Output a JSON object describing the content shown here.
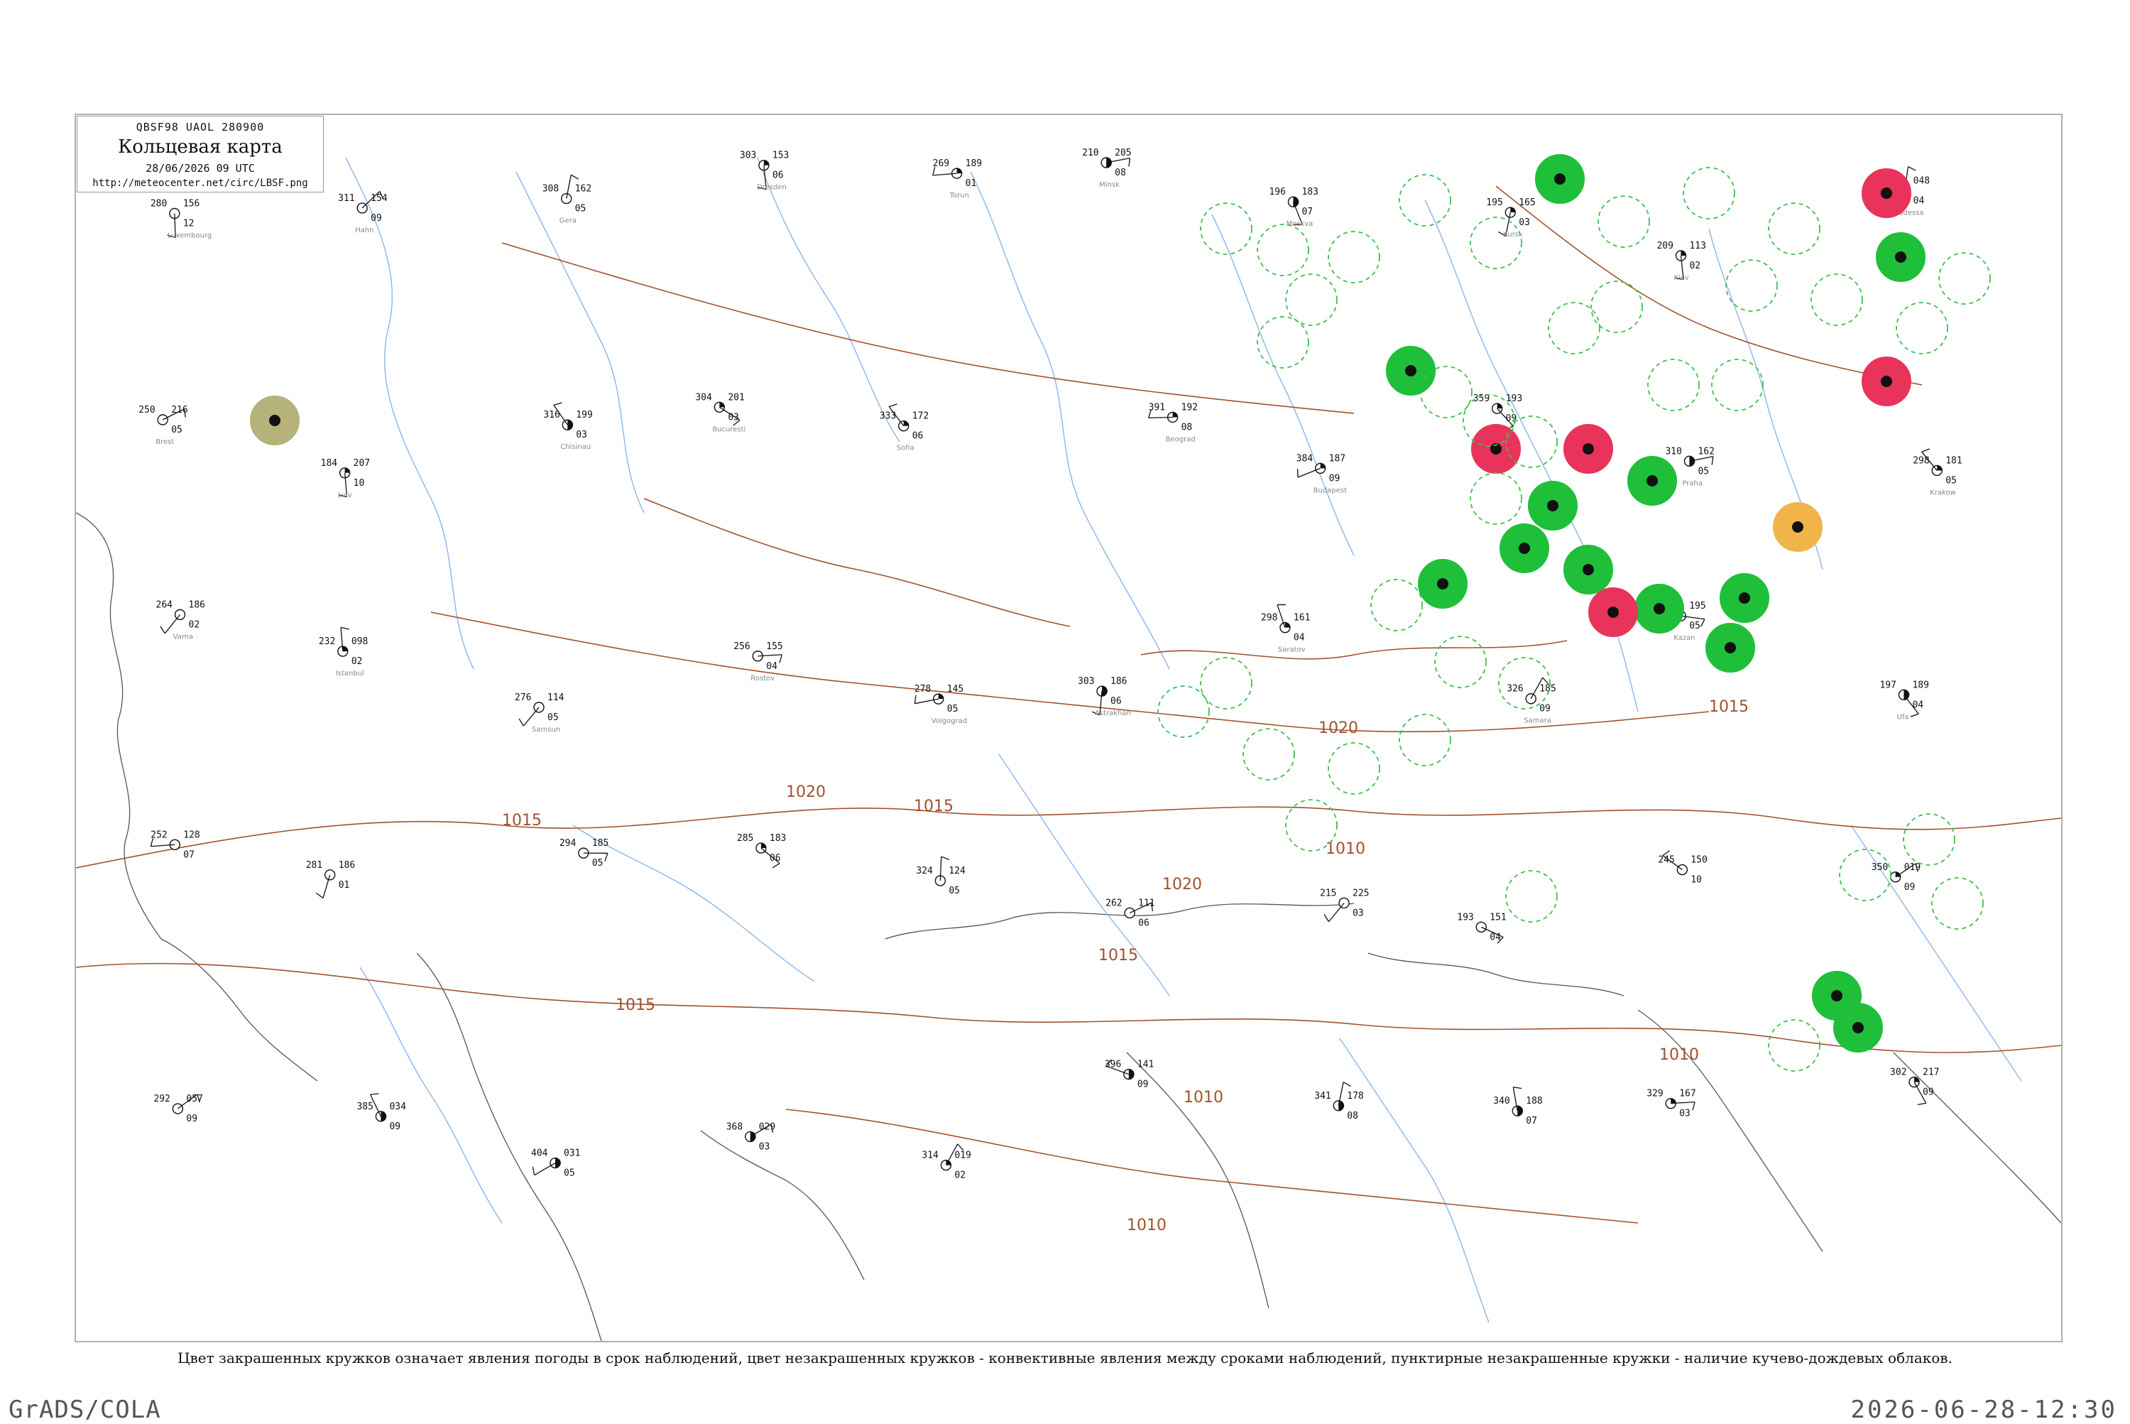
{
  "title_box": {
    "header": "QBSF98  UAOL  280900",
    "title": "Кольцевая карта",
    "datetime": "28/06/2026 09 UTC",
    "url": "http://meteocenter.net/circ/LBSF.png"
  },
  "caption": "Цвет закрашенных кружков означает явления погоды в срок наблюдений, цвет незакрашенных кружков - конвективные явления между сроками наблюдений, пунктирные незакрашенные кружки - наличие кучево-дождевых облаков.",
  "footer": {
    "left": "GrADS/COLA",
    "right": "2026-06-28-12:30"
  },
  "colors": {
    "isobar": "#a0522d",
    "river": "#8ab6e8",
    "coast": "#555555",
    "rain_fill": "#1fbf3a",
    "thunder_fill": "#e8345a",
    "shower_fill": "#f0b44a",
    "fog_fill": "#b5b27a",
    "cb_dash": "#3fbf4f"
  },
  "isobars": [
    {
      "label": "1015"
    },
    {
      "label": "1010"
    },
    {
      "label": "1015"
    },
    {
      "label": "1020"
    },
    {
      "label": "1020"
    },
    {
      "label": "1015"
    },
    {
      "label": "1020"
    },
    {
      "label": "1015"
    },
    {
      "label": "1010"
    },
    {
      "label": "1010"
    },
    {
      "label": "1010"
    },
    {
      "label": "1015"
    }
  ],
  "stations": [
    {
      "t": "280",
      "p": "156",
      "td": "12",
      "id": "s1"
    },
    {
      "t": "311",
      "p": "154",
      "td": "09",
      "id": "s2"
    },
    {
      "t": "308",
      "p": "162",
      "td": "05",
      "id": "s3"
    },
    {
      "t": "303",
      "p": "153",
      "td": "06",
      "id": "s4"
    },
    {
      "t": "269",
      "p": "189",
      "td": "01",
      "id": "s5"
    },
    {
      "t": "210",
      "p": "205",
      "td": "08",
      "id": "s6"
    },
    {
      "t": "196",
      "p": "183",
      "td": "07",
      "id": "s7"
    },
    {
      "t": "195",
      "p": "165",
      "td": "03",
      "id": "s8"
    },
    {
      "t": "209",
      "p": "113",
      "td": "02",
      "id": "s9"
    },
    {
      "t": "161",
      "p": "048",
      "td": "04",
      "id": "s10"
    },
    {
      "t": "250",
      "p": "216",
      "td": "05",
      "id": "s11"
    },
    {
      "t": "184",
      "p": "207",
      "td": "10",
      "id": "s12"
    },
    {
      "t": "316",
      "p": "199",
      "td": "03",
      "id": "s13"
    },
    {
      "t": "304",
      "p": "201",
      "td": "03",
      "id": "s14"
    },
    {
      "t": "333",
      "p": "172",
      "td": "06",
      "id": "s15"
    },
    {
      "t": "391",
      "p": "192",
      "td": "08",
      "id": "s16"
    },
    {
      "t": "384",
      "p": "187",
      "td": "09",
      "id": "s17"
    },
    {
      "t": "359",
      "p": "193",
      "td": "09",
      "id": "s18"
    },
    {
      "t": "310",
      "p": "162",
      "td": "05",
      "id": "s19"
    },
    {
      "t": "298",
      "p": "181",
      "td": "05",
      "id": "s20"
    },
    {
      "t": "264",
      "p": "186",
      "td": "02",
      "id": "s21"
    },
    {
      "t": "232",
      "p": "098",
      "td": "02",
      "id": "s22"
    },
    {
      "t": "276",
      "p": "114",
      "td": "05",
      "id": "s23"
    },
    {
      "t": "256",
      "p": "155",
      "td": "04",
      "id": "s24"
    },
    {
      "t": "278",
      "p": "145",
      "td": "05",
      "id": "s25"
    },
    {
      "t": "303",
      "p": "186",
      "td": "06",
      "id": "s26"
    },
    {
      "t": "298",
      "p": "161",
      "td": "04",
      "id": "s27"
    },
    {
      "t": "326",
      "p": "185",
      "td": "09",
      "id": "s28"
    },
    {
      "t": "264",
      "p": "195",
      "td": "05",
      "id": "s29"
    },
    {
      "t": "197",
      "p": "189",
      "td": "04",
      "id": "s30"
    },
    {
      "t": "252",
      "p": "128",
      "td": "07",
      "id": "s31"
    },
    {
      "t": "281",
      "p": "186",
      "td": "01",
      "id": "s32"
    },
    {
      "t": "294",
      "p": "185",
      "td": "05",
      "id": "s33"
    },
    {
      "t": "285",
      "p": "183",
      "td": "06",
      "id": "s34"
    },
    {
      "t": "324",
      "p": "124",
      "td": "05",
      "id": "s35"
    },
    {
      "t": "262",
      "p": "111",
      "td": "06",
      "id": "s36"
    },
    {
      "t": "215",
      "p": "225",
      "td": "03",
      "id": "s37"
    },
    {
      "t": "193",
      "p": "151",
      "td": "04",
      "id": "s38"
    },
    {
      "t": "245",
      "p": "150",
      "td": "10",
      "id": "s39"
    },
    {
      "t": "350",
      "p": "019",
      "td": "09",
      "id": "s40"
    },
    {
      "t": "292",
      "p": "057",
      "td": "09",
      "id": "s41"
    },
    {
      "t": "385",
      "p": "034",
      "td": "09",
      "id": "s42"
    },
    {
      "t": "404",
      "p": "031",
      "td": "05",
      "id": "s43"
    },
    {
      "t": "368",
      "p": "029",
      "td": "03",
      "id": "s44"
    },
    {
      "t": "314",
      "p": "019",
      "td": "02",
      "id": "s45"
    },
    {
      "t": "396",
      "p": "141",
      "td": "09",
      "id": "s46"
    },
    {
      "t": "341",
      "p": "178",
      "td": "08",
      "id": "s47"
    },
    {
      "t": "340",
      "p": "188",
      "td": "07",
      "id": "s48"
    },
    {
      "t": "329",
      "p": "167",
      "td": "03",
      "id": "s49"
    },
    {
      "t": "302",
      "p": "217",
      "td": "09",
      "id": "s50"
    }
  ],
  "station_names": [
    "Luxembourg",
    "Hahn",
    "Gera",
    "Dresden",
    "Torun",
    "Minsk",
    "Moskva",
    "Kursk",
    "Kiev",
    "Odessa",
    "Brest",
    "Lviv",
    "Chisinau",
    "Bucuresti",
    "Sofia",
    "Beograd",
    "Budapest",
    "Wien",
    "Praha",
    "Krakow",
    "Varna",
    "Istanbul",
    "Samsun",
    "Rostov",
    "Volgograd",
    "Astrakhan",
    "Saratov",
    "Samara",
    "Kazan",
    "Ufa"
  ]
}
